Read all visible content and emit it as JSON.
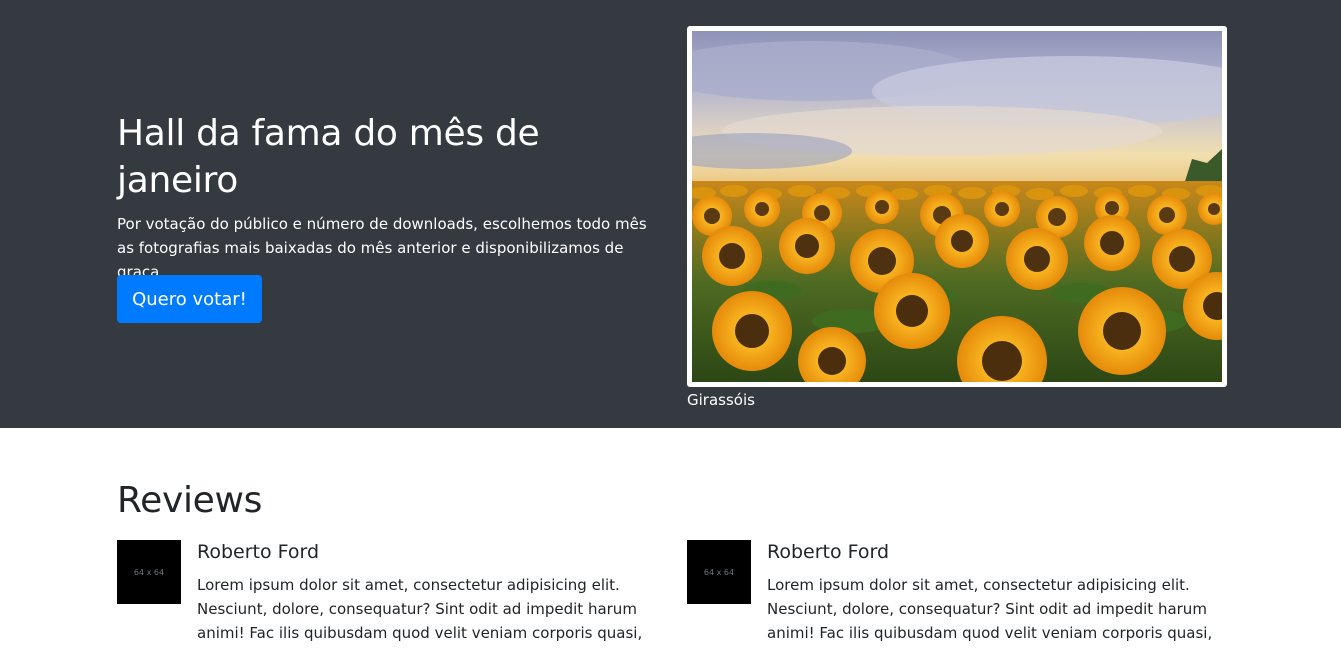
{
  "hero": {
    "title": "Hall da fama do mês de janeiro",
    "description": "Por votação do público e número de downloads, escolhemos todo mês as fotografias mais baixadas do mês anterior e disponibilizamos de graça.",
    "button_label": "Quero votar!",
    "image_caption": "Girassóis",
    "background_color": "#343a40",
    "button_color": "#007bff"
  },
  "reviews": {
    "title": "Reviews",
    "items": [
      {
        "thumbnail_text": "64 x 64",
        "name": "Roberto Ford",
        "text": "Lorem ipsum dolor sit amet, consectetur adipisicing elit. Nesciunt, dolore, consequatur? Sint odit ad impedit harum animi! Fac ilis quibusdam quod velit veniam corporis quasi, quas"
      },
      {
        "thumbnail_text": "64 x 64",
        "name": "Roberto Ford",
        "text": "Lorem ipsum dolor sit amet, consectetur adipisicing elit. Nesciunt, dolore, consequatur? Sint odit ad impedit harum animi! Fac ilis quibusdam quod velit veniam corporis quasi, quas"
      }
    ]
  }
}
